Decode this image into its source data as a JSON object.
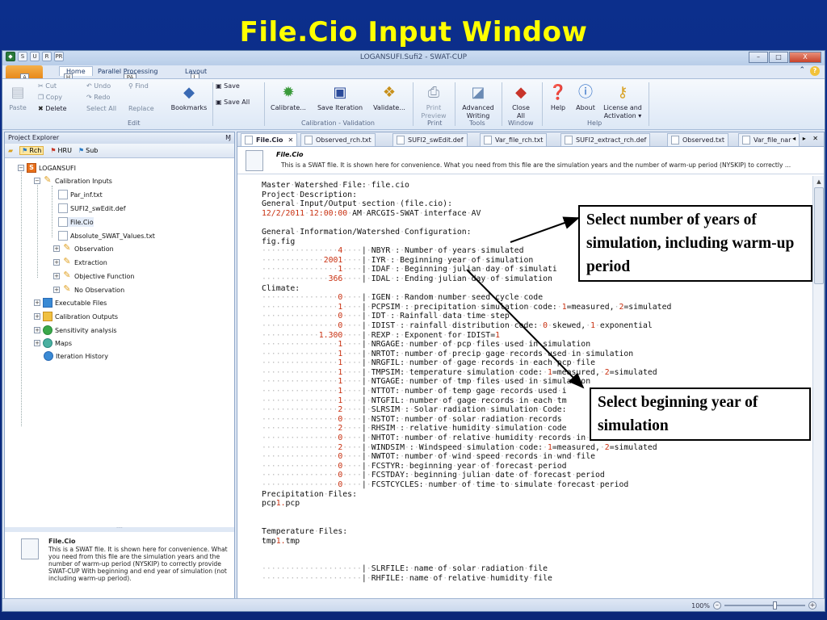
{
  "slide": {
    "title": "File.Cio Input Window"
  },
  "window": {
    "title": "LOGANSUFI.Sufi2 - SWAT-CUP",
    "qat_keys": [
      "S",
      "U",
      "R",
      "PR"
    ],
    "tabs": [
      "Home",
      "Parallel Processing",
      "Layout"
    ],
    "tab_keys": [
      "A",
      "H",
      "PA",
      "L"
    ],
    "help_glyph": "?",
    "win_buttons": [
      "–",
      "□",
      "X"
    ]
  },
  "ribbon": {
    "cut": "Cut",
    "copy": "Copy",
    "paste": "Paste",
    "delete": "Delete",
    "undo": "Undo",
    "redo": "Redo",
    "select_all": "Select All",
    "find": "Find",
    "replace": "Replace",
    "bookmarks": "Bookmarks",
    "save": "Save",
    "save_all": "Save All",
    "calibrate": "Calibrate...",
    "save_iteration": "Save Iteration",
    "validate": "Validate...",
    "print_preview": [
      "Print",
      "Preview"
    ],
    "advanced_writing": [
      "Advanced",
      "Writing"
    ],
    "close_all": [
      "Close",
      "All"
    ],
    "help": "Help",
    "about": "About",
    "license": [
      "License and",
      "Activation ▾"
    ],
    "groups": {
      "edit": "Edit",
      "cal": "Calibration - Validation",
      "print": "Print",
      "tools": "Tools",
      "window": "Window",
      "help": "Help"
    }
  },
  "explorer": {
    "title": "Project Explorer",
    "pin": "Ɱ",
    "tools": [
      "Rch",
      "HRU",
      "Sub"
    ],
    "tree": [
      {
        "label": "LOGANSUFI"
      },
      {
        "label": "Calibration Inputs"
      },
      {
        "label": "Par_inf.txt"
      },
      {
        "label": "SUFI2_swEdit.def"
      },
      {
        "label": "File.Cio"
      },
      {
        "label": "Absolute_SWAT_Values.txt"
      },
      {
        "label": "Observation"
      },
      {
        "label": "Extraction"
      },
      {
        "label": "Objective Function"
      },
      {
        "label": "No Observation"
      },
      {
        "label": "Executable Files"
      },
      {
        "label": "Calibration Outputs"
      },
      {
        "label": "Sensitivity analysis"
      },
      {
        "label": "Maps"
      },
      {
        "label": "Iteration History"
      }
    ],
    "desc_title": "File.Cio",
    "desc_text": "This is a SWAT file. It is shown here for convenience. What you need from this file are the simulation years and the number of warm-up period (NYSKIP) to correctly provide SWAT-CUP With beginning and end year of simulation (not including warm-up period)."
  },
  "editor": {
    "tabs": [
      "File.Cio",
      "Observed_rch.txt",
      "SUFI2_swEdit.def",
      "Var_file_rch.txt",
      "SUFI2_extract_rch.def",
      "Observed.txt",
      "Var_file_nar"
    ],
    "tab_close": "✕",
    "tab_nav": "◂ ▸ ✕",
    "header_title": "File.Cio",
    "header_sub": "This is a SWAT file. It is shown here for convenience. What you need from this file are the simulation years and the number of warm-up period (NYSKIP) to correctly ...",
    "lines": [
      "Master·Watershed·File:·file.cio",
      "Project·Description:",
      "General·Input/Output·section·(file.cio):",
      "12/2/2011·12:00:00·AM·ARCGIS-SWAT·interface·AV",
      "",
      "General·Information/Watershed·Configuration:",
      "fig.fig",
      "················4····|·NBYR·:·Number·of·years·simulated",
      "·············2001····|·IYR·:·Beginning·year·of·simulation",
      "················1····|·IDAF·:·Beginning·julian·day·of·simulati",
      "··············366····|·IDAL·:·Ending·julian·day·of·simulation",
      "Climate:",
      "················0····|·IGEN·:·Random·number·seed·cycle·code",
      "················1····|·PCPSIM·:·precipitation·simulation·code:·1=measured,·2=simulated",
      "················0····|·IDT·:·Rainfall·data·time·step",
      "················0····|·IDIST·:·rainfall·distribution·code:·0·skewed,·1·exponential",
      "············1.300····|·REXP·:·Exponent·for·IDIST=1",
      "················1····|·NRGAGE:·number·of·pcp·files·used·in·simulation",
      "················1····|·NRTOT:·number·of·precip·gage·records·used·in·simulation",
      "················1····|·NRGFIL:·number·of·gage·records·in·each·pcp·file",
      "················1····|·TMPSIM:·temperature·simulation·code:·1=measured,·2=simulated",
      "················1····|·NTGAGE:·number·of·tmp·files·used·in·simulation",
      "················1····|·NTTOT:·number·of·temp·gage·records·used·i",
      "················1····|·NTGFIL:·number·of·gage·records·in·each·tm",
      "················2····|·SLRSIM·:·Solar·radiation·simulation·Code:",
      "················0····|·NSTOT:·number·of·solar·radiation·records",
      "················2····|·RHSIM·:·relative·humidity·simulation·code",
      "················0····|·NHTOT:·number·of·relative·humidity·records·in·hmd·file",
      "················2····|·WINDSIM·:·Windspeed·simulation·code:·1=measured,·2=simulated",
      "················0····|·NWTOT:·number·of·wind·speed·records·in·wnd·file",
      "················0····|·FCSTYR:·beginning·year·of·forecast·period",
      "················0····|·FCSTDAY:·beginning·julian·date·of·forecast·period",
      "················0····|·FCSTCYCLES:·number·of·time·to·simulate·forecast·period",
      "Precipitation·Files:",
      "pcp1.pcp",
      "",
      "",
      "Temperature·Files:",
      "tmp1.tmp",
      "",
      "",
      "·····················|·SLRFILE:·name·of·solar·radiation·file",
      "·····················|·RHFILE:·name·of·relative·humidity·file"
    ]
  },
  "status": {
    "zoom": "100%",
    "minus": "–",
    "plus": "+"
  },
  "callouts": {
    "years": "Select number of years of simulation, including warm-up period",
    "begin": "Select beginning year of simulation"
  },
  "colors": {
    "title": "#ffff00",
    "slide_bg": "#0c2f8c",
    "code_number": "#c83010"
  }
}
